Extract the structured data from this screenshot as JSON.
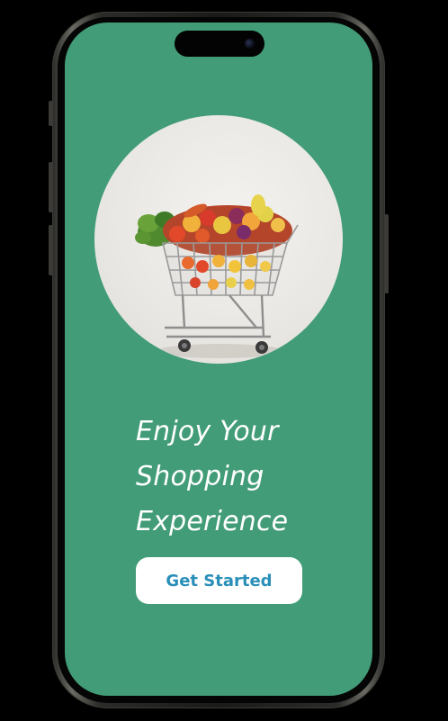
{
  "screen": {
    "background_color": "#419c77",
    "hero_image": {
      "subject": "shopping cart full of fresh fruits and vegetables",
      "icon": "grocery-cart-illustration"
    },
    "headline_lines": [
      "Enjoy Your",
      "Shopping",
      "Experience"
    ],
    "cta": {
      "label": "Get Started",
      "text_color": "#2a8fb8",
      "background_color": "#ffffff"
    }
  }
}
